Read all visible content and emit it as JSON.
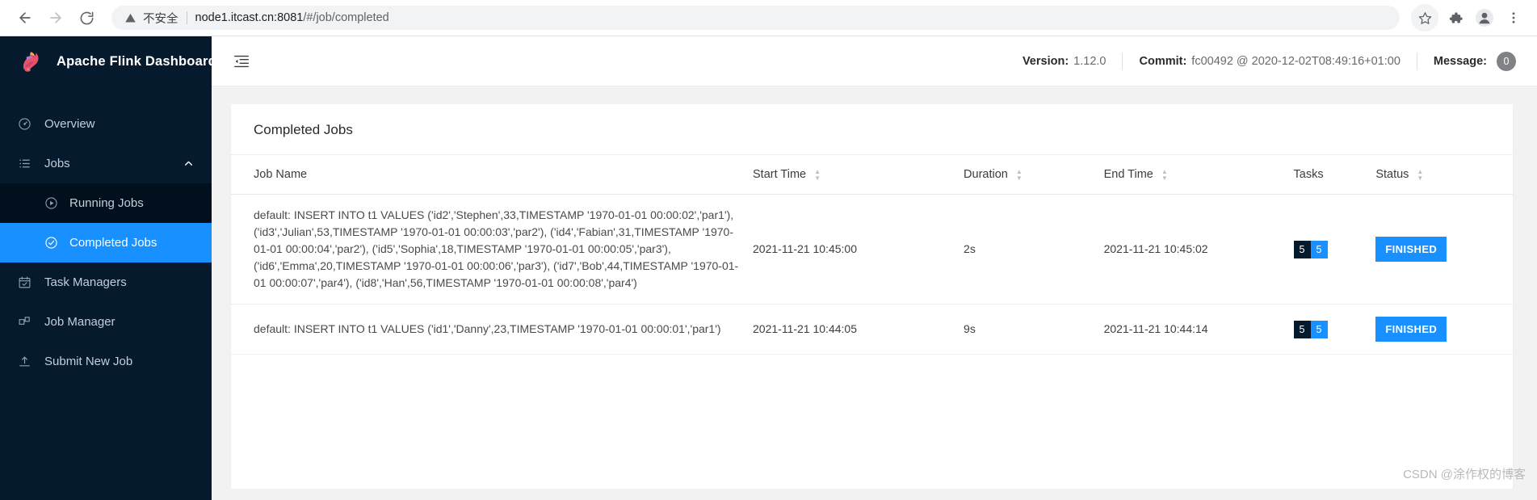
{
  "browser": {
    "back_icon": "arrow-left-icon",
    "forward_icon": "arrow-right-icon",
    "reload_icon": "reload-icon",
    "security_warning_icon": "warning-triangle-icon",
    "security_label": "不安全",
    "url_host": "node1.itcast.cn:8081",
    "url_path": "/#/job/completed",
    "bookmark_icon": "star-icon",
    "extensions_icon": "puzzle-icon",
    "profile_icon": "person-icon",
    "menu_icon": "three-dot-menu-icon"
  },
  "sidebar": {
    "logo_icon": "flink-squirrel-logo",
    "brand": "Apache Flink Dashboard",
    "items": [
      {
        "label": "Overview",
        "icon": "dashboard-icon",
        "level": "top",
        "active": false
      },
      {
        "label": "Jobs",
        "icon": "list-icon",
        "level": "top",
        "active": false,
        "chevron": "chevron-up-icon"
      },
      {
        "label": "Running Jobs",
        "icon": "play-circle-icon",
        "level": "sub",
        "active": false
      },
      {
        "label": "Completed Jobs",
        "icon": "check-circle-icon",
        "level": "sub",
        "active": true
      },
      {
        "label": "Task Managers",
        "icon": "calendar-check-icon",
        "level": "top",
        "active": false
      },
      {
        "label": "Job Manager",
        "icon": "cluster-icon",
        "level": "top",
        "active": false
      },
      {
        "label": "Submit New Job",
        "icon": "upload-icon",
        "level": "top",
        "active": false
      }
    ],
    "colors": {
      "background": "#061a2e",
      "submenu": "#020f1c",
      "active": "#1890ff"
    }
  },
  "topbar": {
    "menu_fold_icon": "menu-fold-icon",
    "version_label": "Version:",
    "version_value": "1.12.0",
    "commit_label": "Commit:",
    "commit_value": "fc00492 @ 2020-12-02T08:49:16+01:00",
    "message_label": "Message:",
    "message_count": "0"
  },
  "main": {
    "card_title": "Completed Jobs",
    "columns": [
      {
        "label": "Job Name",
        "sortable": false
      },
      {
        "label": "Start Time",
        "sortable": true
      },
      {
        "label": "Duration",
        "sortable": true
      },
      {
        "label": "End Time",
        "sortable": true
      },
      {
        "label": "Tasks",
        "sortable": false
      },
      {
        "label": "Status",
        "sortable": true
      }
    ],
    "rows": [
      {
        "job_name": "default: INSERT INTO t1 VALUES ('id2','Stephen',33,TIMESTAMP '1970-01-01 00:00:02','par1'), ('id3','Julian',53,TIMESTAMP '1970-01-01 00:00:03','par2'), ('id4','Fabian',31,TIMESTAMP '1970-01-01 00:00:04','par2'), ('id5','Sophia',18,TIMESTAMP '1970-01-01 00:00:05','par3'), ('id6','Emma',20,TIMESTAMP '1970-01-01 00:00:06','par3'), ('id7','Bob',44,TIMESTAMP '1970-01-01 00:00:07','par4'), ('id8','Han',56,TIMESTAMP '1970-01-01 00:00:08','par4')",
        "start_time": "2021-11-21 10:45:00",
        "duration": "2s",
        "end_time": "2021-11-21 10:45:02",
        "tasks_total": "5",
        "tasks_finished": "5",
        "status": "FINISHED"
      },
      {
        "job_name": "default: INSERT INTO t1 VALUES ('id1','Danny',23,TIMESTAMP '1970-01-01 00:00:01','par1')",
        "start_time": "2021-11-21 10:44:05",
        "duration": "9s",
        "end_time": "2021-11-21 10:44:14",
        "tasks_total": "5",
        "tasks_finished": "5",
        "status": "FINISHED"
      }
    ]
  },
  "watermark": "CSDN @涂作权的博客"
}
